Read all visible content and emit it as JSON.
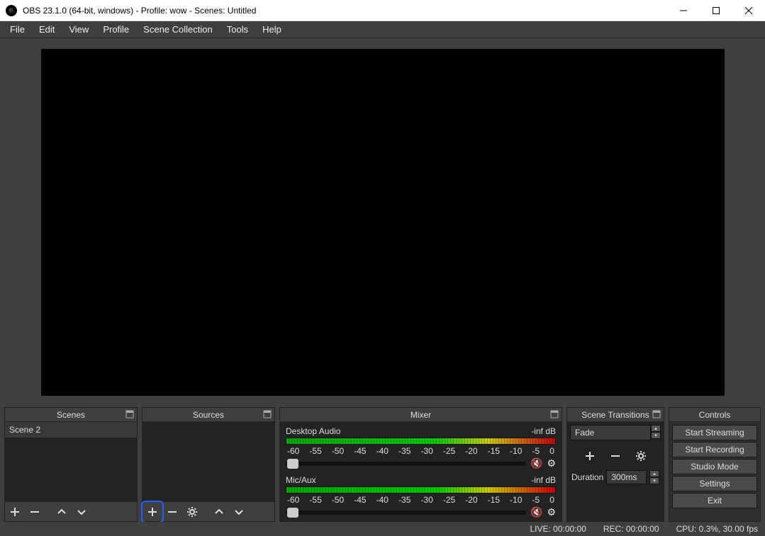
{
  "titlebar": {
    "title": "OBS 23.1.0 (64-bit, windows) - Profile: wow - Scenes: Untitled"
  },
  "menu": [
    "File",
    "Edit",
    "View",
    "Profile",
    "Scene Collection",
    "Tools",
    "Help"
  ],
  "panels": {
    "scenes": {
      "title": "Scenes",
      "items": [
        "Scene 2"
      ]
    },
    "sources": {
      "title": "Sources"
    },
    "mixer": {
      "title": "Mixer",
      "ticks": [
        "-60",
        "-55",
        "-50",
        "-45",
        "-40",
        "-35",
        "-30",
        "-25",
        "-20",
        "-15",
        "-10",
        "-5",
        "0"
      ],
      "channels": [
        {
          "name": "Desktop Audio",
          "level": "-inf dB"
        },
        {
          "name": "Mic/Aux",
          "level": "-inf dB"
        }
      ]
    },
    "transitions": {
      "title": "Scene Transitions",
      "selected": "Fade",
      "duration_label": "Duration",
      "duration_value": "300ms"
    },
    "controls": {
      "title": "Controls",
      "buttons": [
        "Start Streaming",
        "Start Recording",
        "Studio Mode",
        "Settings",
        "Exit"
      ]
    }
  },
  "status": {
    "live": "LIVE: 00:00:00",
    "rec": "REC: 00:00:00",
    "cpu": "CPU: 0.3%, 30.00 fps"
  }
}
